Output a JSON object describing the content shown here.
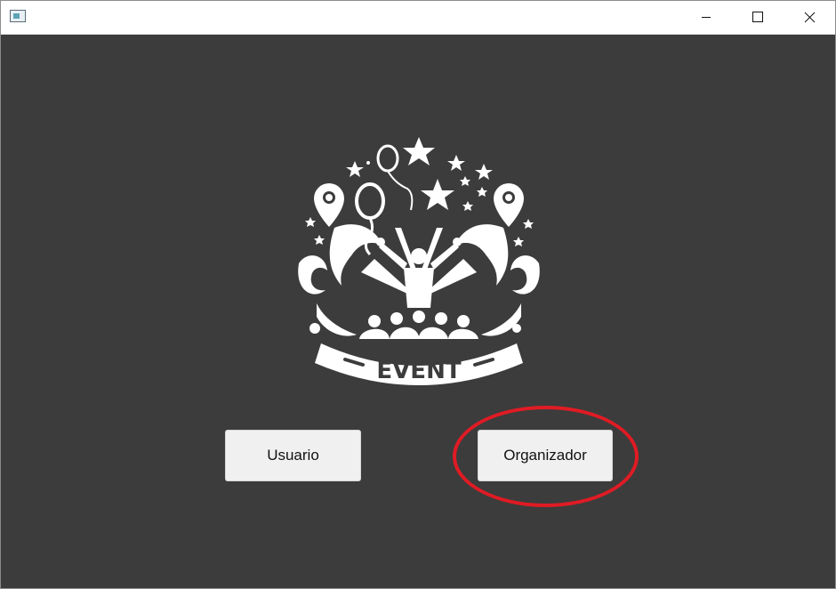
{
  "window": {
    "title": "",
    "controls": [
      "minimize-icon",
      "maximize-icon",
      "close-icon"
    ]
  },
  "logo": {
    "text": "EVENT",
    "icon": "event-emblem"
  },
  "buttons": {
    "usuario_label": "Usuario",
    "organizador_label": "Organizador"
  },
  "colors": {
    "background": "#3c3c3c",
    "button_bg": "#f0f0f0",
    "highlight_ring": "#e01b24",
    "logo": "#ffffff"
  }
}
